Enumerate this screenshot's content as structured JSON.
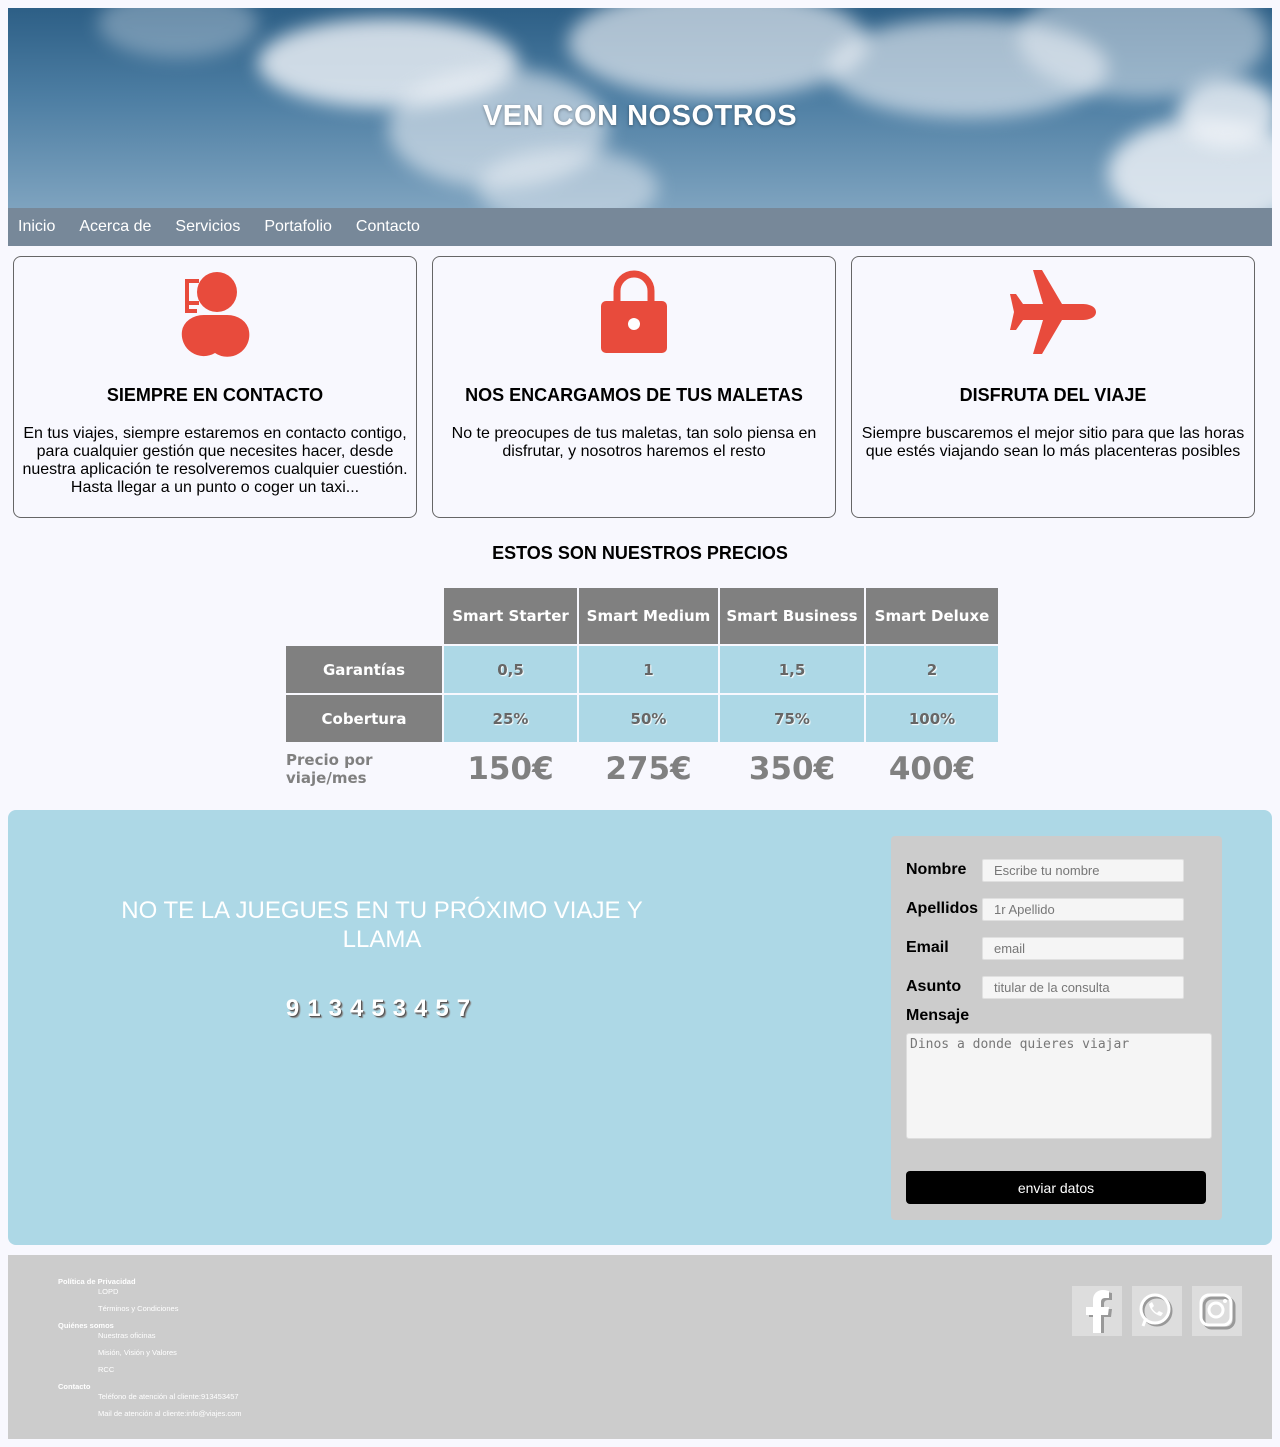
{
  "hero": {
    "title": "VEN CON NOSOTROS"
  },
  "nav": {
    "items": [
      "Inicio",
      "Acerca de",
      "Servicios",
      "Portafolio",
      "Contacto"
    ]
  },
  "features": [
    {
      "icon": "support-agent-icon",
      "title": "SIEMPRE EN CONTACTO",
      "text": "En tus viajes, siempre estaremos en contacto contigo, para cualquier gestión que necesites hacer, desde nuestra aplicación te resolveremos cualquier cuestión. Hasta llegar a un punto o coger un taxi..."
    },
    {
      "icon": "lock-icon",
      "title": "NOS ENCARGAMOS DE TUS MALETAS",
      "text": "No te preocupes de tus maletas, tan solo piensa en disfrutar, y nosotros haremos el resto"
    },
    {
      "icon": "airplane-icon",
      "title": "DISFRUTA DEL VIAJE",
      "text": "Siempre buscaremos el mejor sitio para que las horas que estés viajando sean lo más placenteras posibles"
    }
  ],
  "pricing": {
    "title": "ESTOS SON NUESTROS PRECIOS",
    "plans": [
      "Smart Starter",
      "Smart Medium",
      "Smart Business",
      "Smart Deluxe"
    ],
    "rows": [
      {
        "label": "Garantías",
        "values": [
          "0,5",
          "1",
          "1,5",
          "2"
        ]
      },
      {
        "label": "Cobertura",
        "values": [
          "25%",
          "50%",
          "75%",
          "100%"
        ]
      }
    ],
    "price_label": "Precio por viaje/mes",
    "prices": [
      "150€",
      "275€",
      "350€",
      "400€"
    ]
  },
  "contact": {
    "cta": "NO TE LA JUEGUES EN TU PRÓXIMO VIAJE Y LLAMA",
    "phone": "913453457",
    "form": {
      "nombre_label": "Nombre",
      "nombre_placeholder": "Escribe tu nombre",
      "apellidos_label": "Apellidos",
      "apellidos_placeholder": "1r Apellido",
      "email_label": "Email",
      "email_placeholder": "email",
      "asunto_label": "Asunto",
      "asunto_placeholder": "titular de la consulta",
      "mensaje_label": "Mensaje",
      "mensaje_placeholder": "Dinos a donde quieres viajar",
      "submit": "enviar datos"
    }
  },
  "footer": {
    "sections": [
      {
        "heading": "Política de Privacidad",
        "items": [
          "LOPD",
          "Términos y Condiciones"
        ]
      },
      {
        "heading": "Quiénes somos",
        "items": [
          "Nuestras oficinas",
          "Misión, Visión y Valores",
          "RCC"
        ]
      },
      {
        "heading": "Contacto",
        "items": [
          "Teléfono de atención al cliente:913453457",
          "Mail de atención al cliente:info@viajes.com"
        ]
      }
    ],
    "social": [
      "facebook-icon",
      "whatsapp-icon",
      "instagram-icon"
    ]
  },
  "colors": {
    "accent_red": "#e84b3c",
    "nav_bg": "#778899",
    "table_header": "#808080",
    "table_cell": "#add8e6",
    "contact_bg": "#add8e6",
    "footer_bg": "#cccccc"
  }
}
